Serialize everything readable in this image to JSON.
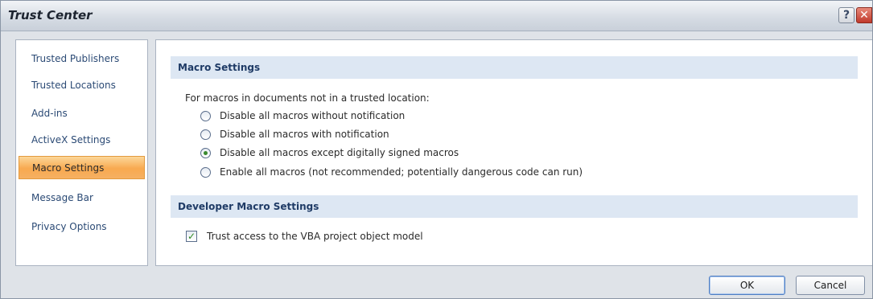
{
  "window": {
    "title": "Trust Center",
    "help_label": "?",
    "close_label": "✕"
  },
  "sidebar": {
    "items": [
      {
        "label": "Trusted Publishers"
      },
      {
        "label": "Trusted Locations"
      },
      {
        "label": "Add-ins"
      },
      {
        "label": "ActiveX Settings"
      },
      {
        "label": "Macro Settings",
        "selected": true
      },
      {
        "label": "Message Bar"
      },
      {
        "label": "Privacy Options"
      }
    ]
  },
  "macro_settings": {
    "header": "Macro Settings",
    "intro": "For macros in documents not in a trusted location:",
    "options": [
      {
        "label": "Disable all macros without notification",
        "checked": false
      },
      {
        "label": "Disable all macros with notification",
        "checked": false
      },
      {
        "label": "Disable all macros except digitally signed macros",
        "checked": true
      },
      {
        "label": "Enable all macros (not recommended; potentially dangerous code can run)",
        "checked": false
      }
    ]
  },
  "developer_settings": {
    "header": "Developer Macro Settings",
    "trust_vba_label": "Trust access to the VBA project object model",
    "trust_vba_checked": true
  },
  "buttons": {
    "ok": "OK",
    "cancel": "Cancel"
  },
  "colors": {
    "selected_item": "#f8a94f",
    "section_header_bg": "#dde7f3",
    "link_text": "#2b4a75"
  }
}
